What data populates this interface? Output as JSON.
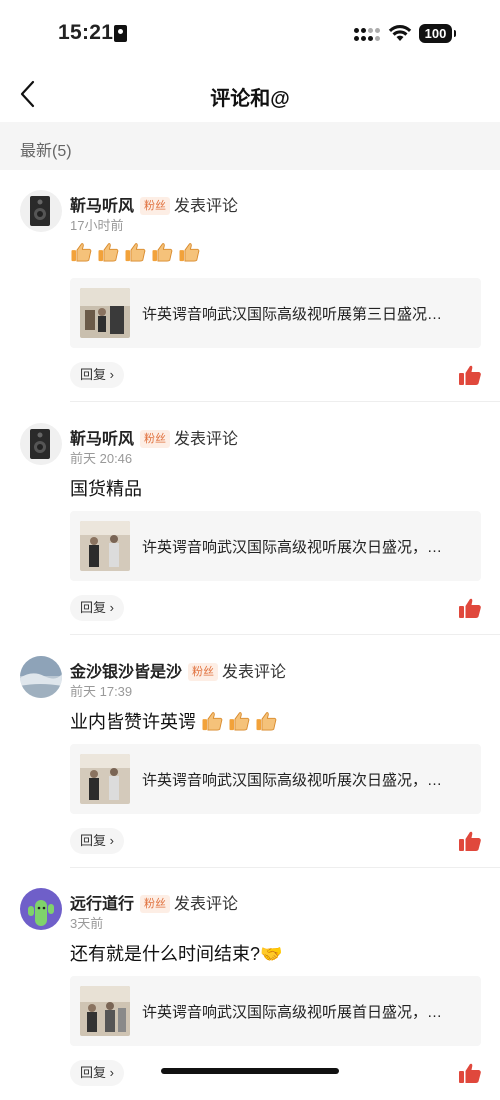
{
  "status_bar": {
    "time": "15:21",
    "battery": "100"
  },
  "nav": {
    "title": "评论和@"
  },
  "section": {
    "label": "最新(5)"
  },
  "comments": [
    {
      "user": "靳马听风",
      "badge": "粉丝",
      "action": "发表评论",
      "time": "17小时前",
      "text": "",
      "emoji_count": 5,
      "article": "许英谔音响武汉国际高级视听展第三日盛况…",
      "reply_label": "回复 ›"
    },
    {
      "user": "靳马听风",
      "badge": "粉丝",
      "action": "发表评论",
      "time": "前天 20:46",
      "text": "国货精品",
      "emoji_count": 0,
      "article": "许英谔音响武汉国际高级视听展次日盛况，…",
      "reply_label": "回复 ›"
    },
    {
      "user": "金沙银沙皆是沙",
      "badge": "粉丝",
      "action": "发表评论",
      "time": "前天 17:39",
      "text": "业内皆赞许英谔",
      "emoji_count": 3,
      "article": "许英谔音响武汉国际高级视听展次日盛况，…",
      "reply_label": "回复 ›"
    },
    {
      "user": "远行道行",
      "badge": "粉丝",
      "action": "发表评论",
      "time": "3天前",
      "text": "还有就是什么时间结束?🤝",
      "emoji_count": 0,
      "article": "许英谔音响武汉国际高级视听展首日盛况，…",
      "reply_label": "回复 ›"
    }
  ],
  "colors": {
    "accent": "#e0483c",
    "badge_text": "#e0703c",
    "badge_bg": "#fdeee5",
    "section_bg": "#f5f5f5"
  }
}
